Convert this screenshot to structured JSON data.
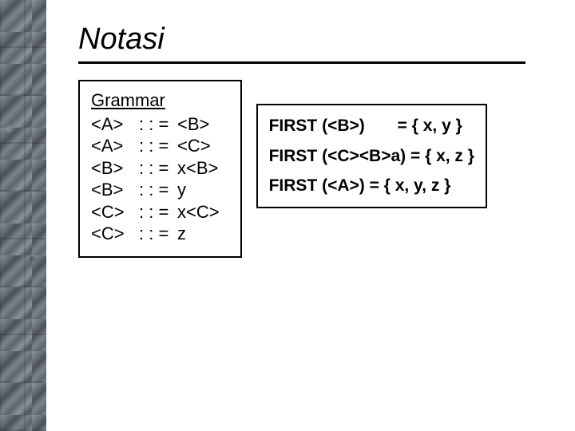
{
  "title": "Notasi",
  "grammar": {
    "header": "Grammar",
    "rules": [
      {
        "lhs": "<A>",
        "op": ": : =",
        "rhs": "<B>"
      },
      {
        "lhs": "<A>",
        "op": ": : =",
        "rhs": "<C>"
      },
      {
        "lhs": "<B>",
        "op": ": : =",
        "rhs": "x<B>"
      },
      {
        "lhs": "<B>",
        "op": ": : =",
        "rhs": "y"
      },
      {
        "lhs": "<C>",
        "op": ": : =",
        "rhs": "x<C>"
      },
      {
        "lhs": "<C>",
        "op": ": : =",
        "rhs": "z"
      }
    ]
  },
  "first": {
    "rows": [
      {
        "left": "FIRST (<B>)",
        "right": "       = { x, y }"
      },
      {
        "left": "FIRST (<C><B>a) = { x, z }",
        "right": ""
      },
      {
        "left": "FIRST (<A>) = { x, y, z }",
        "right": ""
      }
    ]
  }
}
